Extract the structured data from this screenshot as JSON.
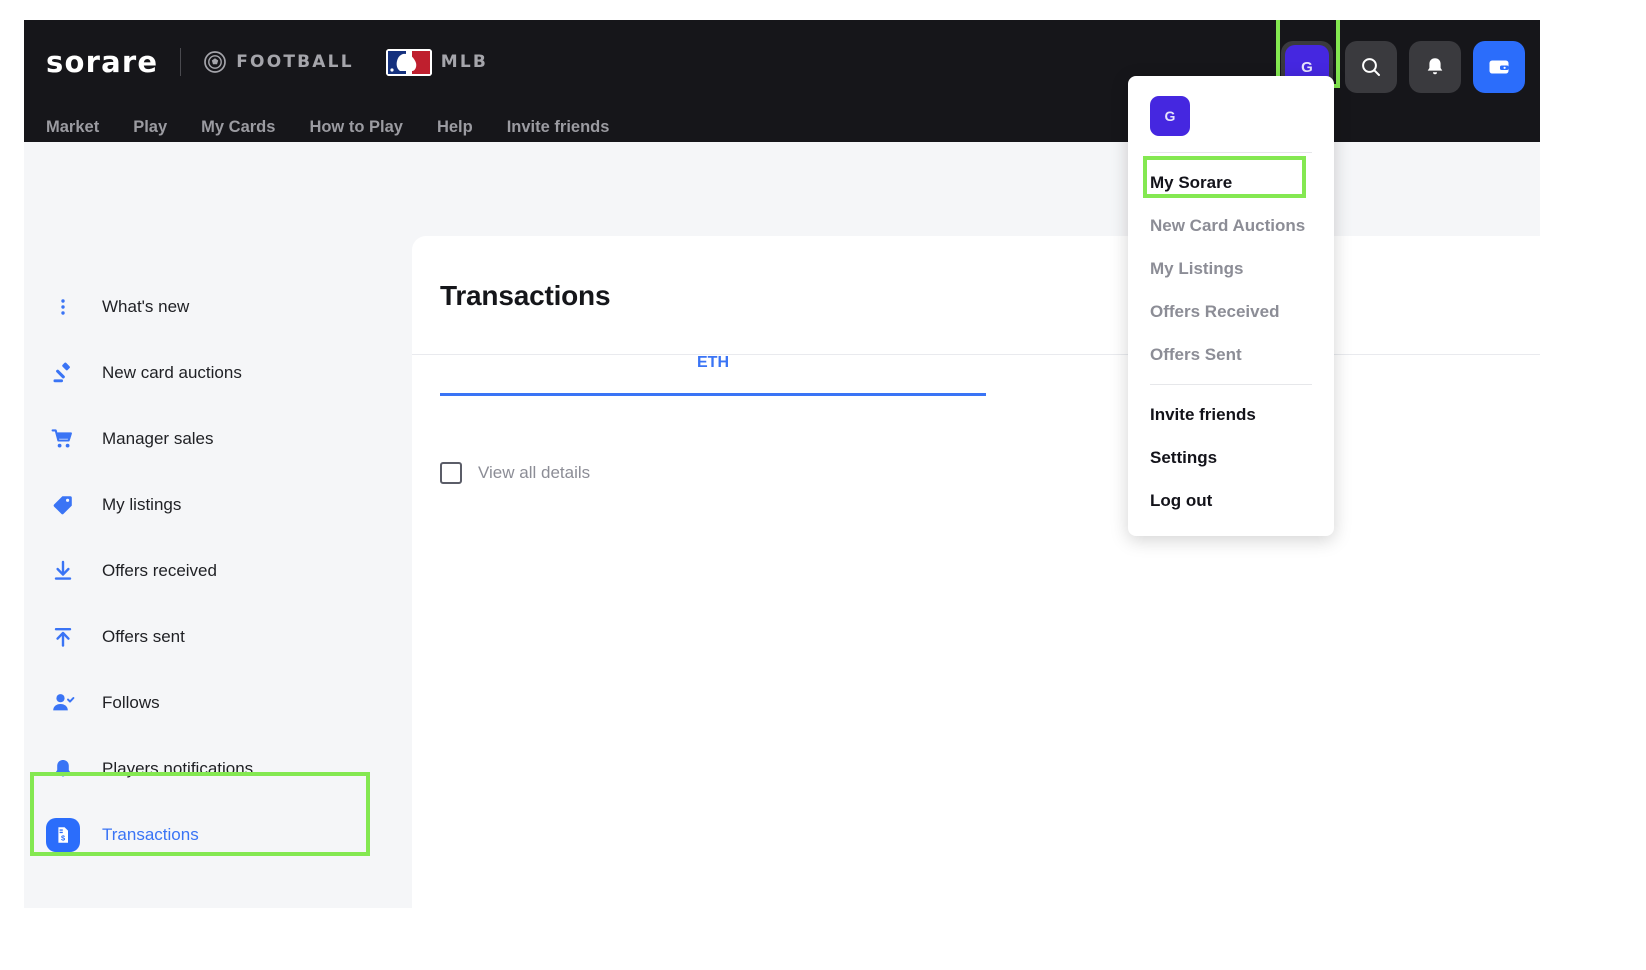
{
  "header": {
    "logo_text": "sorare",
    "sports": [
      {
        "label": "FOOTBALL",
        "icon": "soccer-ball-icon"
      },
      {
        "label": "MLB",
        "icon": "mlb-logo-icon"
      }
    ],
    "nav": [
      "Market",
      "Play",
      "My Cards",
      "How to Play",
      "Help",
      "Invite friends"
    ],
    "actions": {
      "avatar_initial": "G",
      "search_icon": "search-icon",
      "notifications_icon": "bell-icon",
      "wallet_icon": "wallet-icon"
    }
  },
  "dropdown": {
    "avatar_initial": "G",
    "items": [
      {
        "label": "My Sorare",
        "style": "bold"
      },
      {
        "label": "New Card Auctions",
        "style": "muted"
      },
      {
        "label": "My Listings",
        "style": "muted"
      },
      {
        "label": "Offers Received",
        "style": "muted"
      },
      {
        "label": "Offers Sent",
        "style": "muted"
      },
      {
        "label": "Invite friends",
        "style": "bold"
      },
      {
        "label": "Settings",
        "style": "bold"
      },
      {
        "label": "Log out",
        "style": "bold"
      }
    ]
  },
  "sidebar": {
    "items": [
      {
        "label": "What's new",
        "icon": "dots-vertical-icon",
        "active": false
      },
      {
        "label": "New card auctions",
        "icon": "gavel-icon",
        "active": false
      },
      {
        "label": "Manager sales",
        "icon": "shopping-cart-icon",
        "active": false
      },
      {
        "label": "My listings",
        "icon": "tag-icon",
        "active": false
      },
      {
        "label": "Offers received",
        "icon": "download-arrow-icon",
        "active": false
      },
      {
        "label": "Offers sent",
        "icon": "upload-arrow-icon",
        "active": false
      },
      {
        "label": "Follows",
        "icon": "user-check-icon",
        "active": false
      },
      {
        "label": "Players notifications",
        "icon": "bell-icon",
        "active": false
      },
      {
        "label": "Transactions",
        "icon": "receipt-dollar-icon",
        "active": true
      }
    ]
  },
  "main": {
    "title": "Transactions",
    "tabs": [
      {
        "label": "ETH",
        "selected": true
      }
    ],
    "checkbox": {
      "label": "View all details",
      "checked": false
    }
  },
  "colors": {
    "accent_blue": "#3a74f5",
    "avatar_purple": "#4527e0",
    "wallet_blue": "#2b6dfb",
    "highlight_green": "#84e851",
    "header_dark": "#16161a",
    "page_bg": "#f5f6f8"
  }
}
